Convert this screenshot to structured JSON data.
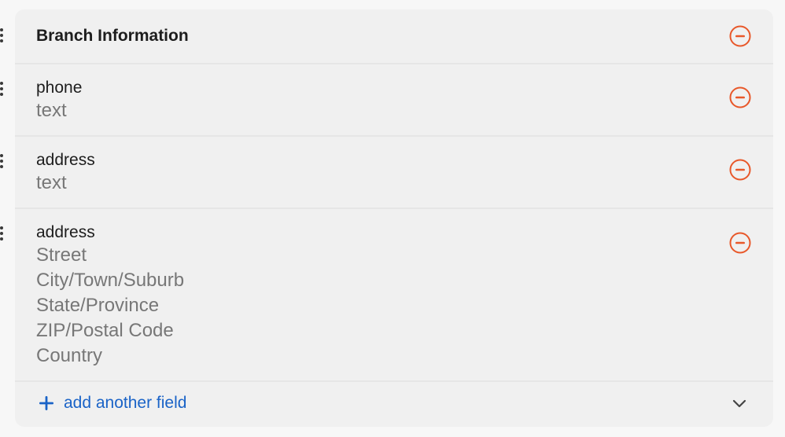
{
  "section": {
    "title": "Branch Information"
  },
  "fields": [
    {
      "name": "phone",
      "types": [
        "text"
      ]
    },
    {
      "name": "address",
      "types": [
        "text"
      ]
    },
    {
      "name": "address",
      "types": [
        "Street",
        "City/Town/Suburb",
        "State/Province",
        "ZIP/Postal Code",
        "Country"
      ]
    }
  ],
  "footer": {
    "add_label": "add another field"
  },
  "colors": {
    "remove_accent": "#e8582a",
    "link_accent": "#1a63c7"
  },
  "icons": {
    "remove": "minus-circle-icon",
    "drag": "drag-handle-icon",
    "add": "plus-icon",
    "expand": "chevron-down-icon"
  }
}
